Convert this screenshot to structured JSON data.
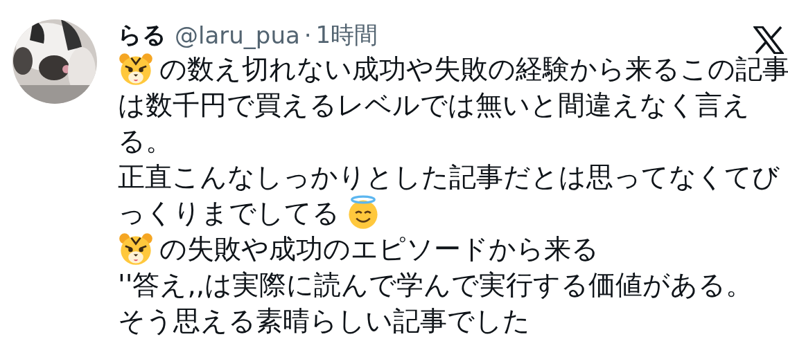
{
  "tweet": {
    "author": {
      "name": "らる",
      "handle": "@laru_pua",
      "separator": "·",
      "time": "1時間"
    },
    "lines": [
      {
        "text": "の数え切れない成功や失敗の経験から来るこの記事",
        "emoji_start": {
          "kind": "tiger"
        }
      },
      {
        "text": "は数千円で買えるレベルでは無いと間違えなく言え"
      },
      {
        "text": "る。"
      },
      {
        "text": "正直こんなしっかりとした記事だとは思ってなくてび"
      },
      {
        "text": "っくりまでしてる",
        "emoji_end": {
          "kind": "halo-smile"
        }
      },
      {
        "text": "の失敗や成功のエピソードから来る",
        "emoji_start": {
          "kind": "tiger"
        }
      },
      {
        "text": "''答え,,は実際に読んで学んで実行する価値がある。"
      },
      {
        "text": "そう思える素晴らしい記事でした"
      }
    ]
  }
}
